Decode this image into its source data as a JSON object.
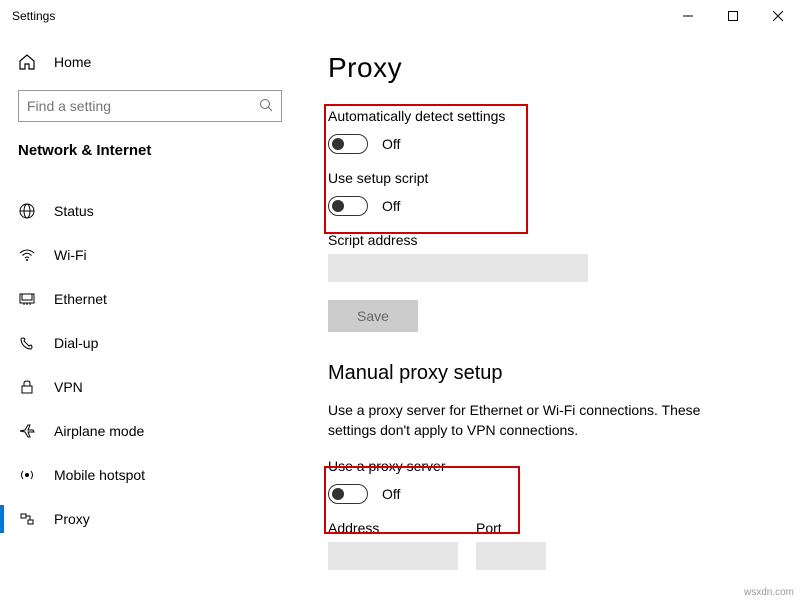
{
  "window": {
    "title": "Settings"
  },
  "sidebar": {
    "home": "Home",
    "search_placeholder": "Find a setting",
    "category": "Network & Internet",
    "items": [
      {
        "label": "Status"
      },
      {
        "label": "Wi-Fi"
      },
      {
        "label": "Ethernet"
      },
      {
        "label": "Dial-up"
      },
      {
        "label": "VPN"
      },
      {
        "label": "Airplane mode"
      },
      {
        "label": "Mobile hotspot"
      },
      {
        "label": "Proxy"
      }
    ]
  },
  "content": {
    "title": "Proxy",
    "auto_detect": {
      "label": "Automatically detect settings",
      "state": "Off"
    },
    "setup_script": {
      "label": "Use setup script",
      "state": "Off"
    },
    "script_address": {
      "label": "Script address",
      "value": ""
    },
    "save": "Save",
    "manual": {
      "title": "Manual proxy setup",
      "desc": "Use a proxy server for Ethernet or Wi-Fi connections. These settings don't apply to VPN connections.",
      "use_proxy": {
        "label": "Use a proxy server",
        "state": "Off"
      },
      "address_label": "Address",
      "port_label": "Port"
    }
  },
  "watermark": "wsxdn.com"
}
